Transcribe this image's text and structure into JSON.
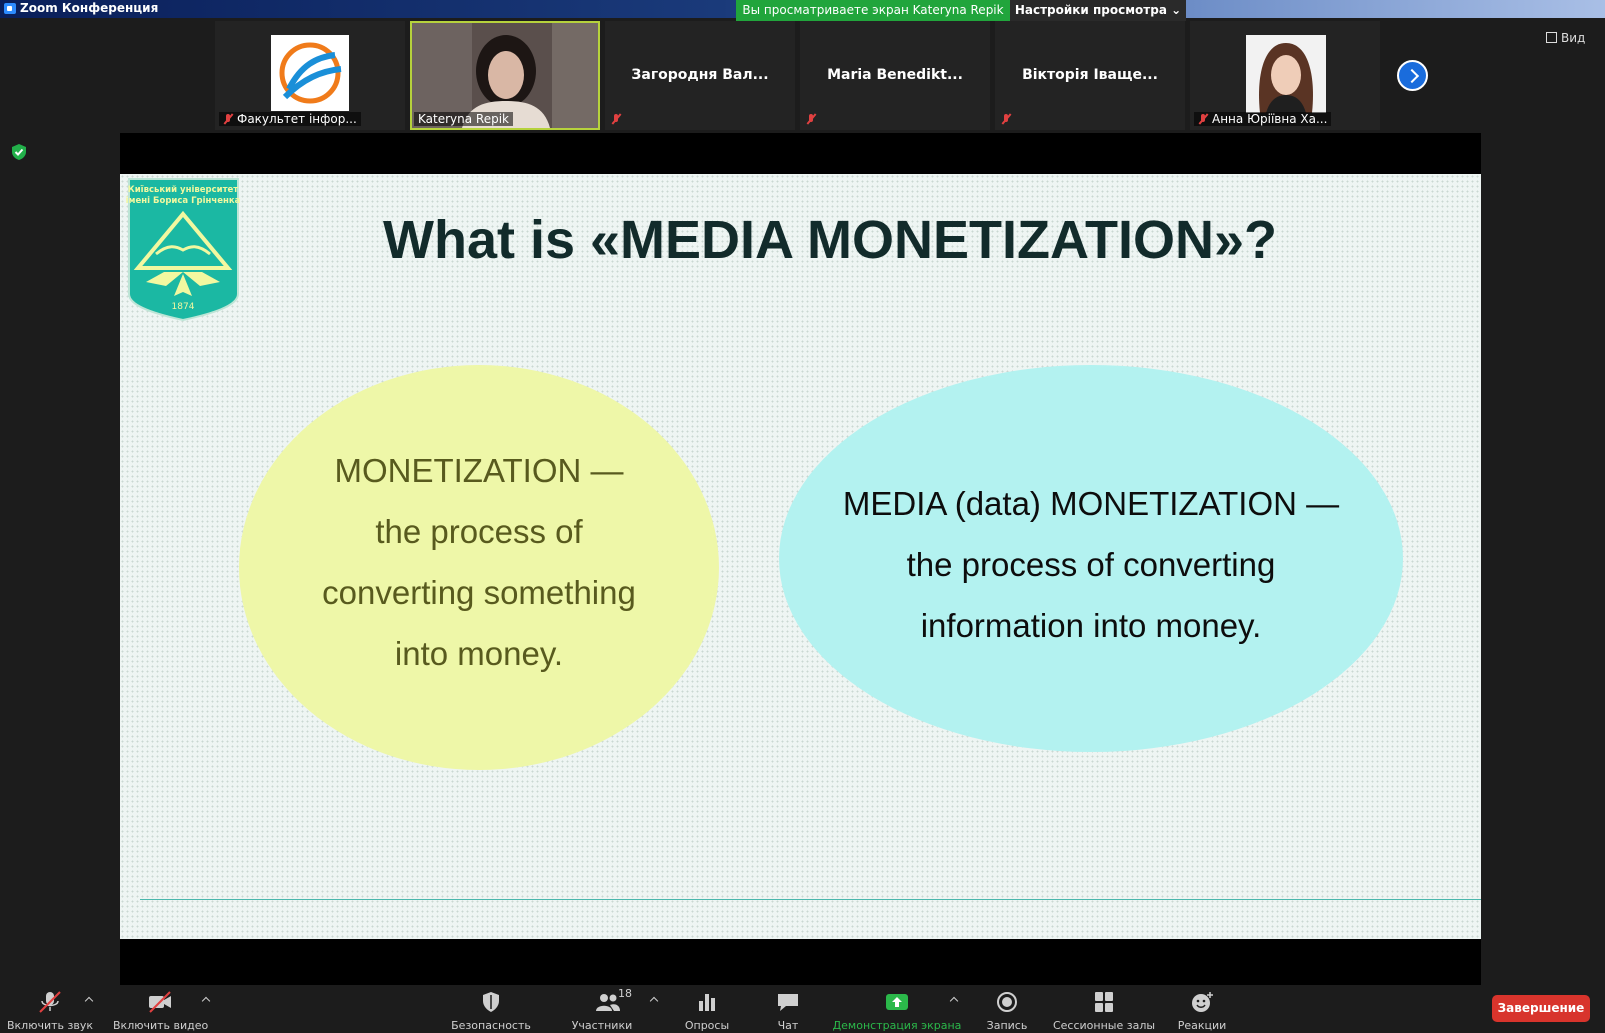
{
  "window": {
    "title": "Zoom Конференция"
  },
  "banner": {
    "sharing_text": "Вы просматриваете экран Kateryna Repik",
    "view_settings": "Настройки просмотра"
  },
  "view_button": "Вид",
  "participants": [
    {
      "name": "Факультет інфор...",
      "muted": true,
      "has_video": false,
      "avatar": "logo"
    },
    {
      "name": "Kateryna Repik",
      "muted": false,
      "has_video": true,
      "active_speaker": true
    },
    {
      "name": "Загородня  Вал...",
      "muted": true,
      "has_video": false
    },
    {
      "name": "Maria  Benedikt...",
      "muted": true,
      "has_video": false
    },
    {
      "name": "Вікторія Іваще...",
      "muted": true,
      "has_video": false
    },
    {
      "name": "Анна Юріївна Ха...",
      "muted": true,
      "has_video": false,
      "avatar": "photo"
    }
  ],
  "slide": {
    "logo_text": [
      "Київський університет",
      "імені Бориса Грінченка"
    ],
    "logo_year": "1874",
    "title": "What is «MEDIA MONETIZATION»?",
    "left_bubble": [
      "MONETIZATION —",
      "the process of",
      "converting something",
      "into money."
    ],
    "right_bubble": [
      "MEDIA (data) MONETIZATION —",
      "the process of converting",
      "information into money."
    ],
    "colors": {
      "left_bubble": "#eef7a8",
      "right_bubble": "#b3f2f0",
      "title": "#122b2b",
      "logo": "#1bb8a3"
    }
  },
  "toolbar": {
    "unmute": "Включить звук",
    "start_video": "Включить видео",
    "security": "Безопасность",
    "participants": "Участники",
    "participants_count": "18",
    "polls": "Опросы",
    "chat": "Чат",
    "share_screen": "Демонстрация экрана",
    "record": "Запись",
    "breakout_rooms": "Сессионные залы",
    "reactions": "Реакции",
    "end": "Завершение"
  },
  "colors": {
    "share_green": "#21a53c",
    "end_red": "#d8342c",
    "accent_blue": "#1a6cdc"
  }
}
